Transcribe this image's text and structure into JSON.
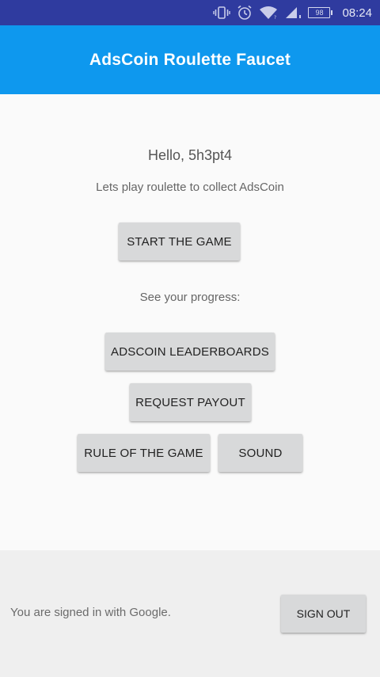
{
  "status_bar": {
    "battery": "98",
    "time": "08:24",
    "icons": [
      "vibrate-icon",
      "alarm-icon",
      "wifi-icon",
      "signal-icon",
      "battery-icon"
    ]
  },
  "app_bar": {
    "title": "AdsCoin Roulette Faucet",
    "color": "#0e98ee"
  },
  "main": {
    "greeting": "Hello, 5h3pt4",
    "subtitle": "Lets play roulette to collect AdsCoin",
    "start_button": "START THE GAME",
    "progress_label": "See your progress:",
    "leaderboards_button": "ADSCOIN LEADERBOARDS",
    "payout_button": "REQUEST PAYOUT",
    "rules_button": "RULE OF THE GAME",
    "sound_button": "SOUND"
  },
  "footer": {
    "signed_in_text": "You are signed in with Google.",
    "sign_out_button": "SIGN OUT"
  }
}
